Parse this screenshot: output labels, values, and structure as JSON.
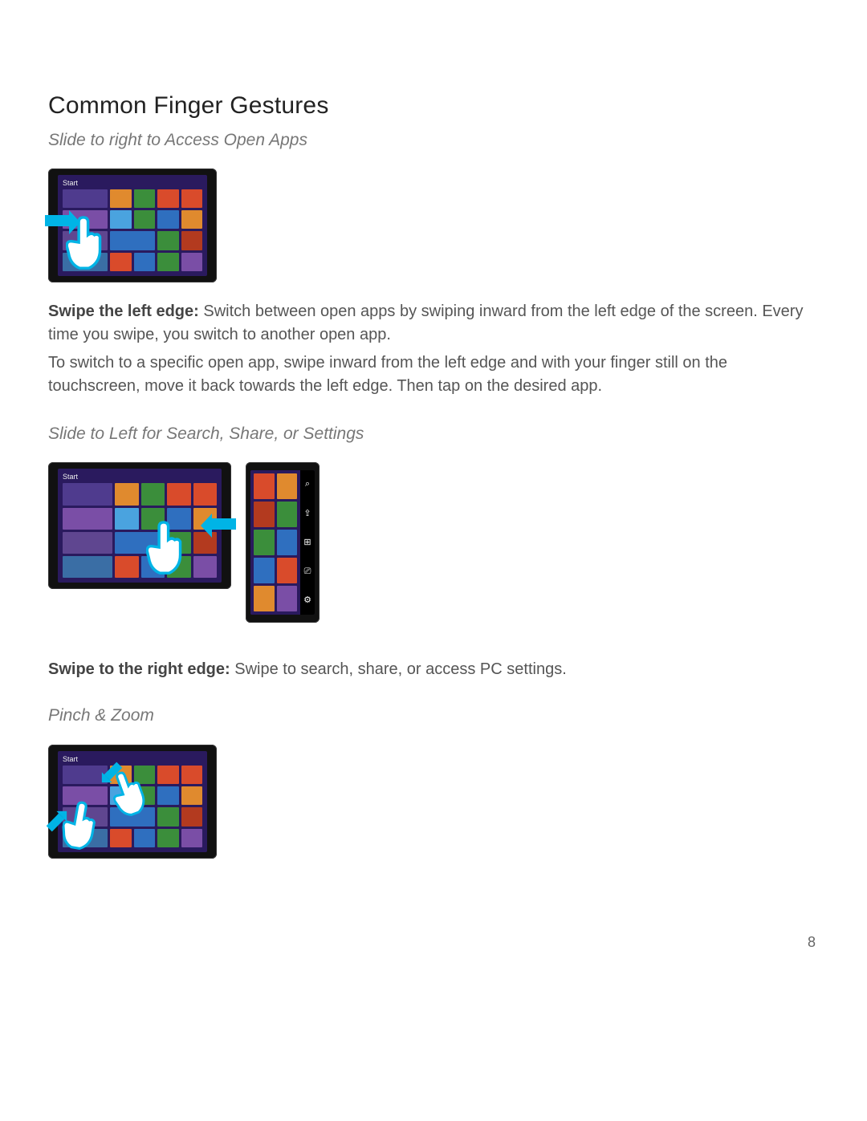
{
  "heading": "Common Finger Gestures",
  "section1": {
    "subhead": "Slide to right to Access Open Apps",
    "bold": "Swipe the left edge:",
    "body": " Switch between open apps by swiping inward from the left edge of the screen. Every time you swipe, you switch to another open app.",
    "body2": "To switch to a specific open app, swipe inward from the left edge and with your finger still on the touchscreen, move it back towards the left edge. Then tap on the desired app."
  },
  "section2": {
    "subhead": "Slide to Left for Search, Share, or Settings",
    "bold": "Swipe to the right edge:",
    "body": " Swipe to search, share, or access PC settings."
  },
  "section3": {
    "subhead": "Pinch & Zoom"
  },
  "ui": {
    "start_label": "Start",
    "charms": {
      "search": "⌕",
      "share": "⇪",
      "start": "⊞",
      "devices": "⎚",
      "settings": "⚙"
    }
  },
  "page_number": "8"
}
